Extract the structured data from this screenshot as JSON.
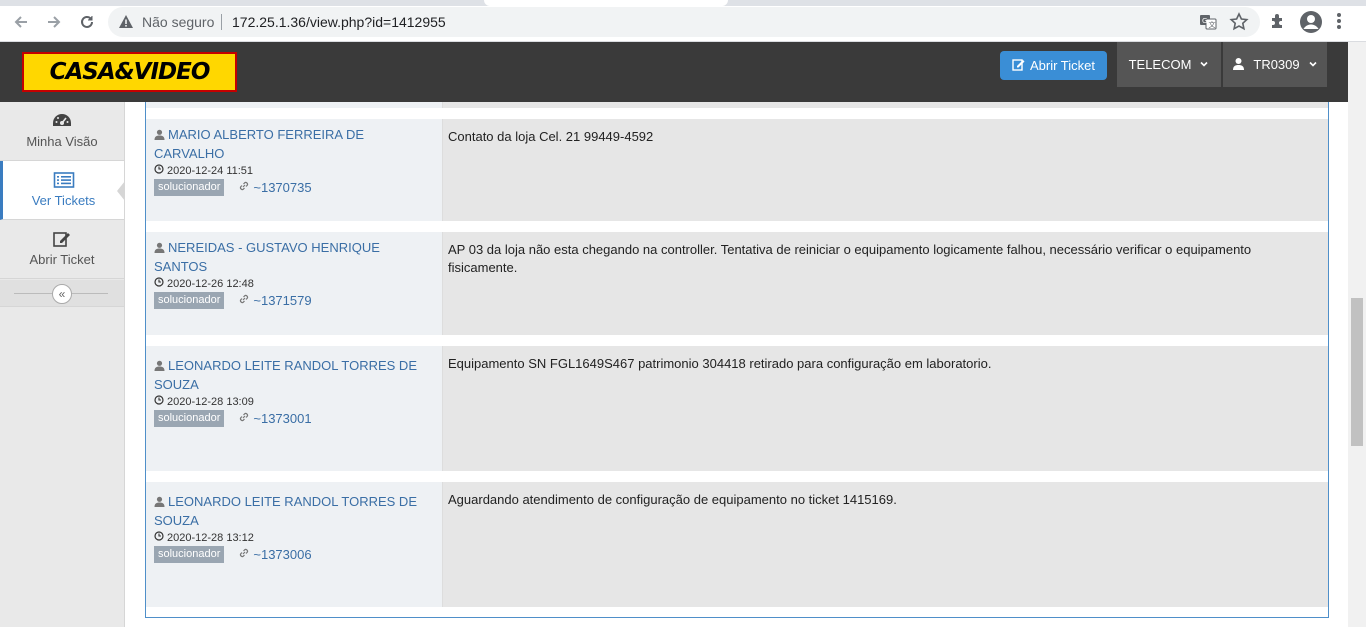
{
  "browser": {
    "insecure_label": "Não seguro",
    "url": "172.25.1.36/view.php?id=1412955"
  },
  "header": {
    "logo_text": "CASA&VIDEO",
    "open_ticket_label": "Abrir Ticket",
    "group_label": "TELECOM",
    "user_label": "TR0309"
  },
  "sidebar": {
    "items": [
      {
        "label": "Minha Visão",
        "icon": "dashboard-icon"
      },
      {
        "label": "Ver Tickets",
        "icon": "list-icon"
      },
      {
        "label": "Abrir Ticket",
        "icon": "edit-icon"
      }
    ],
    "collapse_icon": "double-chevron-left-icon"
  },
  "entries": [
    {
      "author": "MARIO ALBERTO FERREIRA DE CARVALHO",
      "datetime": "2020-12-24 11:51",
      "role": "solucionador",
      "ref": "~1370735",
      "message": "Contato da loja Cel. 21 99449-4592"
    },
    {
      "author": "NEREIDAS - GUSTAVO HENRIQUE SANTOS",
      "datetime": "2020-12-26 12:48",
      "role": "solucionador",
      "ref": "~1371579",
      "message": "AP 03 da loja não esta chegando na controller. Tentativa de reiniciar o equipamento logicamente falhou, necessário verificar o equipamento fisicamente."
    },
    {
      "author": "LEONARDO LEITE RANDOL TORRES DE SOUZA",
      "datetime": "2020-12-28 13:09",
      "role": "solucionador",
      "ref": "~1373001",
      "message": "Equipamento SN FGL1649S467 patrimonio 304418 retirado para configuração em laboratorio."
    },
    {
      "author": "LEONARDO LEITE RANDOL TORRES DE SOUZA",
      "datetime": "2020-12-28 13:12",
      "role": "solucionador",
      "ref": "~1373006",
      "message": "Aguardando atendimento de configuração de equipamento no ticket 1415169."
    }
  ],
  "colors": {
    "header_bg": "#3a3a3a",
    "accent": "#3a8ed6",
    "link": "#3a6ea5",
    "logo_yellow": "#ffd700",
    "logo_red": "#c40000"
  }
}
